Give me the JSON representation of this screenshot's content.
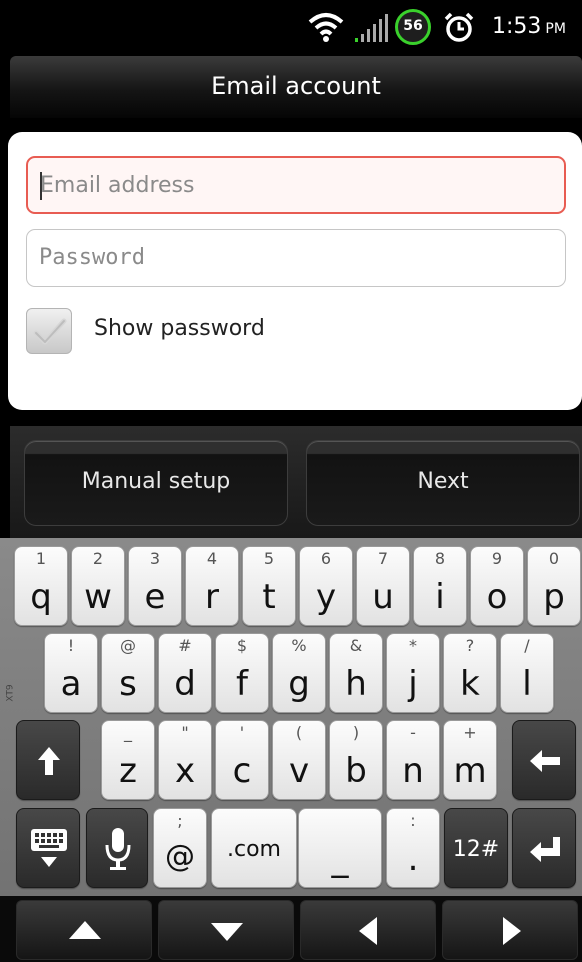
{
  "status_bar": {
    "battery": "56",
    "time": "1:53",
    "ampm": "PM"
  },
  "title": "Email account",
  "form": {
    "email_placeholder": "Email address",
    "password_placeholder": "Password",
    "show_password_label": "Show password"
  },
  "buttons": {
    "manual_setup": "Manual setup",
    "next": "Next"
  },
  "keyboard": {
    "side_label": "XT9",
    "row1": [
      {
        "alt": "1",
        "main": "q"
      },
      {
        "alt": "2",
        "main": "w"
      },
      {
        "alt": "3",
        "main": "e"
      },
      {
        "alt": "4",
        "main": "r"
      },
      {
        "alt": "5",
        "main": "t"
      },
      {
        "alt": "6",
        "main": "y"
      },
      {
        "alt": "7",
        "main": "u"
      },
      {
        "alt": "8",
        "main": "i"
      },
      {
        "alt": "9",
        "main": "o"
      },
      {
        "alt": "0",
        "main": "p"
      }
    ],
    "row2": [
      {
        "alt": "!",
        "main": "a"
      },
      {
        "alt": "@",
        "main": "s"
      },
      {
        "alt": "#",
        "main": "d"
      },
      {
        "alt": "$",
        "main": "f"
      },
      {
        "alt": "%",
        "main": "g"
      },
      {
        "alt": "&",
        "main": "h"
      },
      {
        "alt": "*",
        "main": "j"
      },
      {
        "alt": "?",
        "main": "k"
      },
      {
        "alt": "/",
        "main": "l"
      }
    ],
    "row3": [
      {
        "alt": "_",
        "main": "z"
      },
      {
        "alt": "\"",
        "main": "x"
      },
      {
        "alt": "'",
        "main": "c"
      },
      {
        "alt": "(",
        "main": "v"
      },
      {
        "alt": ")",
        "main": "b"
      },
      {
        "alt": "-",
        "main": "n"
      },
      {
        "alt": "+",
        "main": "m"
      }
    ],
    "at_key": {
      "alt": ";",
      "main": "@"
    },
    "dotcom": ".com",
    "underscore": "_",
    "period_key": {
      "alt": ":",
      "main": "."
    },
    "numbers_key": "12#"
  }
}
